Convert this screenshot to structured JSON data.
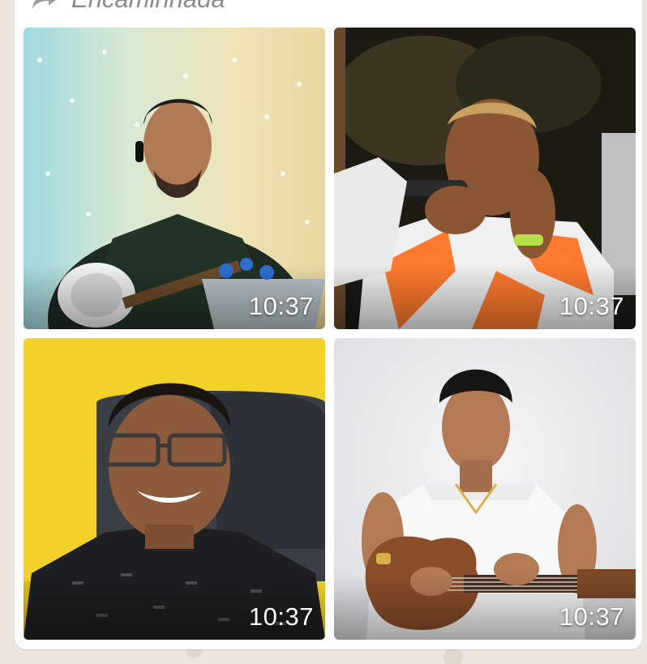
{
  "message": {
    "forwarded_label": "Encaminhada",
    "media": [
      {
        "time": "10:37",
        "description": "photo-man-playing-instrument"
      },
      {
        "time": "10:37",
        "description": "photo-man-singing-microphone"
      },
      {
        "time": "10:37",
        "description": "photo-man-smiling-glasses"
      },
      {
        "time": "10:37",
        "description": "photo-young-man-with-guitar"
      }
    ]
  },
  "colors": {
    "bubble": "#ffffff",
    "chat_wallpaper": "#ece5dd",
    "meta_text": "#8a8a8a",
    "timestamp": "#ffffff"
  },
  "icons": {
    "forwarded": "forward-arrow-icon"
  }
}
